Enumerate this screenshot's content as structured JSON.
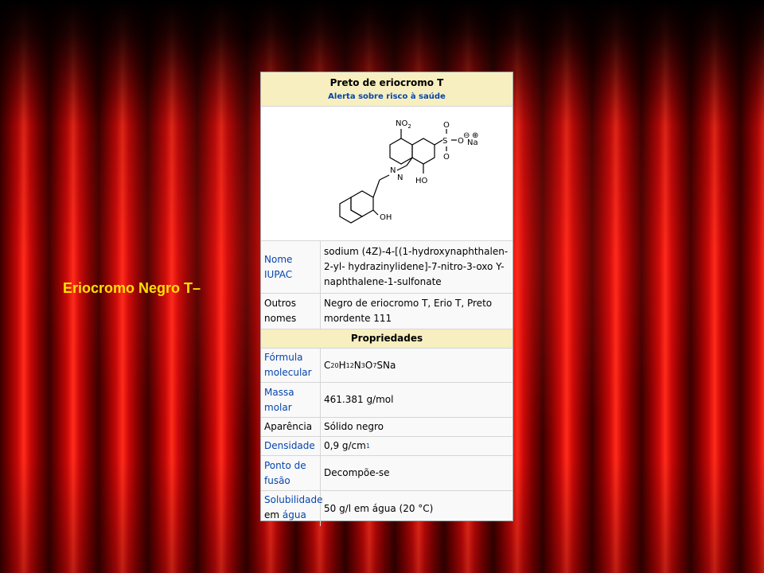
{
  "slide": {
    "title": "Eriocromo Negro T–"
  },
  "infobox": {
    "title": "Preto de eriocromo T",
    "hazard_link": "Alerta sobre risco à saúde",
    "structure": {
      "no2": "NO",
      "no2_sub": "2",
      "o1": "O",
      "o2": "O",
      "o3": "O",
      "s": "S",
      "minus": "⊖",
      "na": "Na",
      "plus": "⊕",
      "n1": "N",
      "n2": "N",
      "ho": "HO",
      "oh": "OH"
    },
    "iupac": {
      "label": "Nome IUPAC",
      "value": "sodium (4Z)-4-[(1-hydroxynaphthalen-2-yl- hydrazinylidene]-7-nitro-3-oxo Y-naphthalene-1-sulfonate"
    },
    "other_names": {
      "label": "Outros nomes",
      "value": "Negro de eriocromo T, Erio T, Preto mordente 111"
    },
    "properties_header": "Propriedades",
    "formula": {
      "label": "Fórmula molecular",
      "parts": [
        "C",
        "20",
        "H",
        "12",
        "N",
        "3",
        "O",
        "7",
        "SNa"
      ]
    },
    "molar_mass": {
      "label": "Massa molar",
      "value": "461.381 g/mol"
    },
    "appearance": {
      "label": "Aparência",
      "value": "Sólido negro"
    },
    "density": {
      "label": "Densidade",
      "value": "0,9 g/cm",
      "sup": "1"
    },
    "melting_point": {
      "label": "Ponto de fusão",
      "value": "Decompõe-se"
    },
    "solubility": {
      "label1": "Solubilidade",
      "label2": "em",
      "label_link": "água",
      "value": "50 g/l em água (20 °C)"
    }
  }
}
